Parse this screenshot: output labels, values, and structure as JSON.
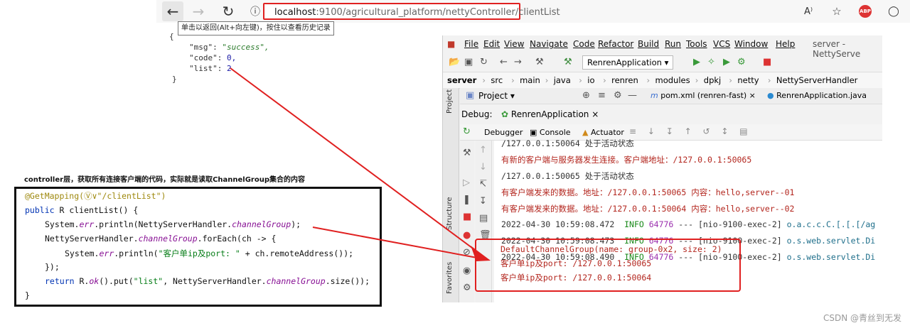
{
  "browser": {
    "url_host": "localhost",
    "url_rest": ":9100/agricultural_platform/nettyController/clientList",
    "tooltip": "单击以返回(Alt+向左键)，按住以查看历史记录",
    "back_icon": "arrow-left-icon",
    "forward_icon": "arrow-right-icon",
    "reload_icon": "reload-icon",
    "info_icon": "info-icon",
    "read_aloud": "A⁾",
    "abp_label": "ABP"
  },
  "json_output": {
    "open": "{",
    "msg_key": "\"msg\":",
    "msg_val": "\"success\",",
    "code_key": "\"code\":",
    "code_val": "0,",
    "list_key": "\"list\":",
    "list_val": "2",
    "close": "}"
  },
  "caption": "controller层，获取所有连接客户端的代码，实际就是读取ChannelGroup集合的内容",
  "code": {
    "l1_ann": "@GetMapping(",
    "l1_rest": "Ⓥ∨\"/clientList\")",
    "l2_kw": "public",
    "l2_rest": " R clientList() {",
    "l3_a": "System.",
    "l3_it": "err",
    "l3_b": ".println(NettyServerHandler.",
    "l3_it2": "channelGroup",
    "l3_c": ");",
    "l4_a": "NettyServerHandler.",
    "l4_it": "channelGroup",
    "l4_b": ".forEach(ch -> {",
    "l5_a": "System.",
    "l5_it": "err",
    "l5_b": ".println(",
    "l5_str": "\"客户单ip及port: \"",
    "l5_c": " + ch.remoteAddress());",
    "l6": "});",
    "l7_kw": "return",
    "l7_a": " R.",
    "l7_it": "ok",
    "l7_b": "().put(",
    "l7_str": "\"list\"",
    "l7_c": ", NettyServerHandler.",
    "l7_it2": "channelGroup",
    "l7_d": ".size());",
    "l8": "}"
  },
  "ide": {
    "menu": [
      "File",
      "Edit",
      "View",
      "Navigate",
      "Code",
      "Refactor",
      "Build",
      "Run",
      "Tools",
      "VCS",
      "Window",
      "Help"
    ],
    "window_title": "server - NettyServe",
    "run_config": "RenrenApplication",
    "breadcrumb": [
      "server",
      "src",
      "main",
      "java",
      "io",
      "renren",
      "modules",
      "dpkj",
      "netty",
      "NettyServerHandler"
    ],
    "project_label": "Project",
    "tab_pom": "pom.xml (renren-fast)",
    "tab_app": "RenrenApplication.java",
    "debug_label": "Debug:",
    "debug_config": "RenrenApplication",
    "tab_debugger": "Debugger",
    "tab_console": "Console",
    "tab_actuator": "Actuator",
    "side_project": "Project",
    "side_structure": "Structure",
    "side_favorites": "Favorites",
    "console": [
      {
        "text": "/127.0.0.1:50064 处于活动状态",
        "cls": "cdark"
      },
      {
        "text": "有新的客户端与服务器发生连接。客户端地址：/127.0.0.1:50065",
        "cls": "cred"
      },
      {
        "text": "/127.0.0.1:50065 处于活动状态",
        "cls": "cdark"
      },
      {
        "text": "有客户端发来的数据。地址：/127.0.0.1:50065 内容：hello,server--01",
        "cls": "cred"
      },
      {
        "text": "有客户端发来的数据。地址：/127.0.0.1:50064 内容：hello,server--02",
        "cls": "cred"
      }
    ],
    "log_lines": [
      {
        "time": "2022-04-30 10:59:08.472",
        "level": "INFO",
        "pid": "64776",
        "thread": "--- [nio-9100-exec-2]",
        "cls": "o.a.c.c.C.[.[.[/ag"
      },
      {
        "time": "2022-04-30 10:59:08.473",
        "level": "INFO",
        "pid": "64776",
        "thread": "--- [nio-9100-exec-2]",
        "cls": "o.s.web.servlet.Di"
      },
      {
        "time": "2022-04-30 10:59:08.490",
        "level": "INFO",
        "pid": "64776",
        "thread": "--- [nio-9100-exec-2]",
        "cls": "o.s.web.servlet.Di"
      }
    ],
    "highlight_lines": [
      "DefaultChannelGroup(name: group-0x2, size: 2)",
      "客户单ip及port: /127.0.0.1:50065",
      "客户单ip及port: /127.0.0.1:50064"
    ]
  },
  "watermark": "CSDN @青丝到无发",
  "colors": {
    "annotation_red": "#e02020",
    "console_red": "#b3261e"
  }
}
